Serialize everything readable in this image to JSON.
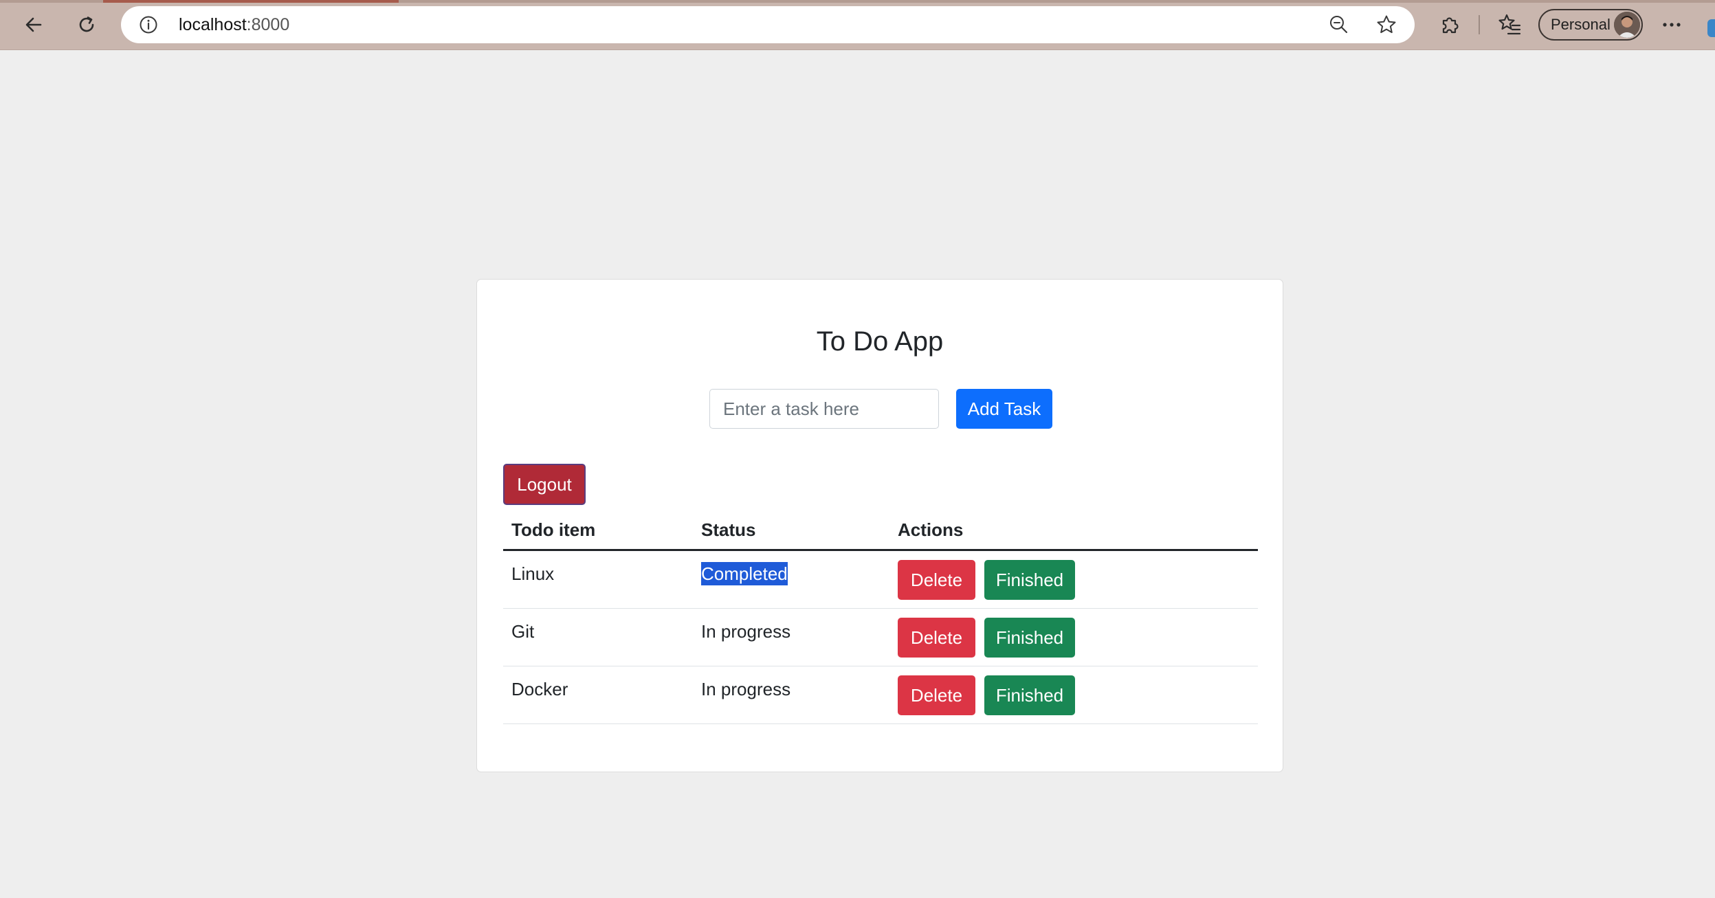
{
  "browser": {
    "url_host": "localhost",
    "url_port": ":8000",
    "profile_label": "Personal"
  },
  "app": {
    "title": "To Do App",
    "input_placeholder": "Enter a task here",
    "add_button": "Add Task",
    "logout_button": "Logout"
  },
  "table": {
    "headers": [
      "Todo item",
      "Status",
      "Actions"
    ],
    "rows": [
      {
        "item": "Linux",
        "status": "Completed",
        "delete": "Delete",
        "finish": "Finished"
      },
      {
        "item": "Git",
        "status": "In progress",
        "delete": "Delete",
        "finish": "Finished"
      },
      {
        "item": "Docker",
        "status": "In progress",
        "delete": "Delete",
        "finish": "Finished"
      }
    ]
  },
  "colors": {
    "primary": "#0d6efd",
    "danger": "#dc3545",
    "success": "#198754",
    "logout": "#b02a37",
    "selection": "#1f5bd8"
  }
}
